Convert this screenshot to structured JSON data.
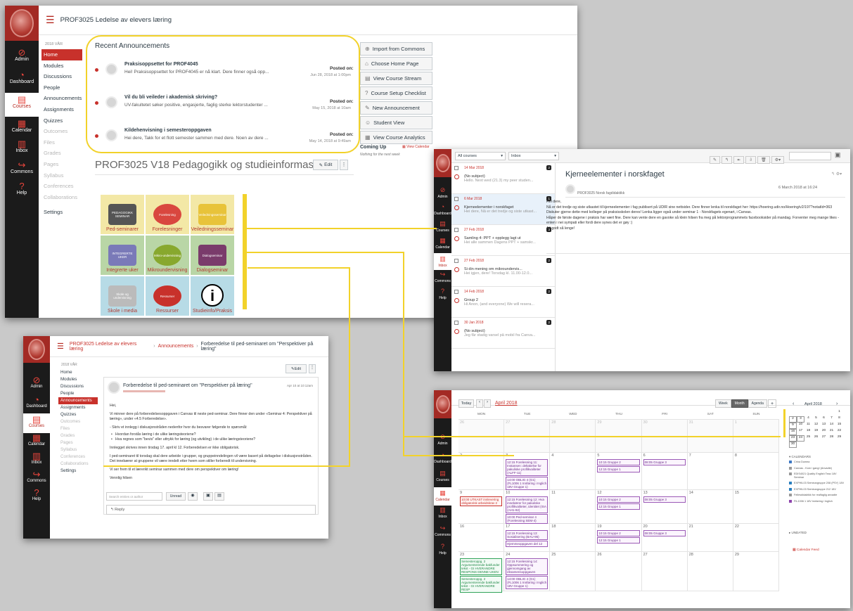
{
  "win1": {
    "course_title": "PROF3025 Ledelse av elevers læring",
    "term": "2018 VÅR",
    "global_nav": [
      "Admin",
      "Dashboard",
      "Courses",
      "Calendar",
      "Inbox",
      "Commons",
      "Help"
    ],
    "course_nav": [
      {
        "label": "Home",
        "state": "active"
      },
      {
        "label": "Modules",
        "state": "normal"
      },
      {
        "label": "Discussions",
        "state": "normal"
      },
      {
        "label": "People",
        "state": "normal"
      },
      {
        "label": "Announcements",
        "state": "normal"
      },
      {
        "label": "Assignments",
        "state": "normal"
      },
      {
        "label": "Quizzes",
        "state": "normal"
      },
      {
        "label": "Outcomes",
        "state": "dim"
      },
      {
        "label": "Files",
        "state": "dim"
      },
      {
        "label": "Grades",
        "state": "dim"
      },
      {
        "label": "Pages",
        "state": "dim"
      },
      {
        "label": "Syllabus",
        "state": "dim"
      },
      {
        "label": "Conferences",
        "state": "dim"
      },
      {
        "label": "Collaborations",
        "state": "dim"
      },
      {
        "label": "Settings",
        "state": "normal"
      }
    ],
    "recent_heading": "Recent Announcements",
    "posted_on": "Posted on:",
    "announcements": [
      {
        "title": "Praksisoppsettet for PROF4045",
        "body": "Hei! Praksisoppsettet for PROF4045 er nå klart. Dere finner også opp...",
        "date": "Jun 28, 2018 at 1:00pm"
      },
      {
        "title": "Vil du bli veileder i akademisk skriving?",
        "body": "UV-fakultetet søker positive, engasjerte, faglig sterke lektorstudenter ...",
        "date": "May 15, 2018 at 10am"
      },
      {
        "title": "Kildehenvisning i semesteroppgaven",
        "body": "Hei dere, Takk for et flott semester sammen med dere. Noen av dere ...",
        "date": "May 14, 2018 at 9:49am"
      }
    ],
    "page_title": "PROF3025 V18 Pedagogikk og studieinformasjon",
    "edit_label": "Edit",
    "side_buttons": [
      {
        "icon": "import-icon",
        "glyph": "⊕",
        "label": "Import from Commons"
      },
      {
        "icon": "home-icon",
        "glyph": "⌂",
        "label": "Choose Home Page"
      },
      {
        "icon": "stream-icon",
        "glyph": "▤",
        "label": "View Course Stream"
      },
      {
        "icon": "checklist-icon",
        "glyph": "?",
        "label": "Course Setup Checklist"
      },
      {
        "icon": "announcement-icon",
        "glyph": "✎",
        "label": "New Announcement"
      },
      {
        "icon": "student-icon",
        "glyph": "☺",
        "label": "Student View"
      },
      {
        "icon": "analytics-icon",
        "glyph": "▦",
        "label": "View Course Analytics"
      }
    ],
    "coming_up": "Coming Up",
    "view_calendar": "View Calendar",
    "nothing": "Nothing for the next week",
    "tiles": [
      {
        "label": "Ped-seminarer",
        "art": "PEDAGOGIKK SEMINAR",
        "bg": "#f3e8a6"
      },
      {
        "label": "Forelesninger",
        "art": "Forelesning",
        "bg": "#f3e8a6"
      },
      {
        "label": "Veiledningsseminar",
        "art": "Veiledningsseminar",
        "bg": "#f3e8a6"
      },
      {
        "label": "Integrerte uker",
        "art": "INTEGRERTE UKER",
        "bg": "#b9d6a6"
      },
      {
        "label": "Mikroundervisning",
        "art": "Mikro-undervisning",
        "bg": "#b9d6a6"
      },
      {
        "label": "Dialogseminar",
        "art": "Dialogseminar",
        "bg": "#b9d6a6"
      },
      {
        "label": "Skole i media",
        "art": "Skole og undervisning",
        "bg": "#b7dbe6"
      },
      {
        "label": "Ressurser",
        "art": "Ressurser",
        "bg": "#b7dbe6"
      },
      {
        "label": "Studieinfo/Praksis",
        "art": "i",
        "bg": "#b7dbe6"
      }
    ]
  },
  "win2": {
    "filter_courses": "All courses",
    "filter_box": "Inbox",
    "messages": [
      {
        "date": "14 Mar 2018",
        "count": "2",
        "subject": "(No subject)",
        "preview": "Hello. Next wed (21.3) my peer studen..."
      },
      {
        "date": "6 Mar 2018",
        "count": "1",
        "subject": "Kjerneelementer i norskfaget",
        "preview": "Hei dere, Nå er det tredje og siste utkast..."
      },
      {
        "date": "27 Feb 2018",
        "count": "3",
        "subject": "Samling 4: PPT + opplegg lagt ut",
        "preview": "Hei alle sammen Dagens PPT + samskr..."
      },
      {
        "date": "27 Feb 2018",
        "count": "2",
        "subject": "Si din mening om mikroundervis...",
        "preview": "Hei igjen, dere! Torsdag kl. 11.00-12.0..."
      },
      {
        "date": "14 Feb 2018",
        "count": "2",
        "subject": "Group 2",
        "preview": "Hi Anon, (and everyone) We will resera..."
      },
      {
        "date": "30 Jan 2018",
        "count": "2",
        "subject": "(No subject)",
        "preview": "Jeg får stadig varsel på mobil fra Canva..."
      }
    ],
    "msg_title": "Kjerneelementer i norskfaget",
    "msg_from": "PROF3025 Norsk fagdidaktikk",
    "msg_date": "6 March 2018 at 16:24",
    "msg_body": [
      "Hei dere,",
      "Nå er det tredje og siste utkastet til kjerneelementer i fag publisert på UDIR sine nettsider. Dere finner lenka til norskfaget her: https://hoering.udir.no/Hoering/v2/197?notatId=363",
      "Diskuter gjerne dette med kolleger på praksisskolen deres! Lenka ligger også under seminar 1 - Norskfagets egenart, i Canvas.",
      "Håper de første dagene i praksis har vært fine. Dere kan vente dere en gavoke så klein hilsen fra meg på lektorprogrammets facebooksider på mandag. Forventer meg mange likes - enten i nei sympati eller fordi dere synes det er gøy :)",
      "Alt godt så lenge!"
    ]
  },
  "win3": {
    "breadcrumb": [
      "PROF3025 Ledelse av elevers læring",
      "Announcements",
      "Forberedelse til ped-seminaret om \"Perspektiver på læring\""
    ],
    "course_nav": [
      {
        "label": "Home",
        "state": "normal"
      },
      {
        "label": "Modules",
        "state": "normal"
      },
      {
        "label": "Discussions",
        "state": "normal"
      },
      {
        "label": "People",
        "state": "normal"
      },
      {
        "label": "Announcements",
        "state": "active"
      },
      {
        "label": "Assignments",
        "state": "normal"
      },
      {
        "label": "Quizzes",
        "state": "normal"
      },
      {
        "label": "Outcomes",
        "state": "dim"
      },
      {
        "label": "Files",
        "state": "dim"
      },
      {
        "label": "Grades",
        "state": "dim"
      },
      {
        "label": "Pages",
        "state": "dim"
      },
      {
        "label": "Syllabus",
        "state": "dim"
      },
      {
        "label": "Conferences",
        "state": "dim"
      },
      {
        "label": "Collaborations",
        "state": "dim"
      },
      {
        "label": "Settings",
        "state": "normal"
      }
    ],
    "title": "Forberedelse til ped-seminaret om \"Perspektiver på læring\"",
    "date": "Apr 10 at 10:12am",
    "greeting": "Hei,",
    "paragraphs": [
      "Vi minner dere på forberedelsesoppgaven i Canvas til neste ped-seminar. Dere finner den under «Seminar 4: Perspektiver på læring», under «4.5 Forberedelse».",
      "- Skriv et innlegg i diskusjonstråden nedenfor hvor du besvarer følgende to spørsmål:",
      "Hvordan forstås læring i de ulike læringsteoriene?",
      "Hva regnes som \"bevis\" eller uttrykk for læring (og utvikling) i de ulike læringsteoriene?",
      "Innlegget skrives innen tirsdag 17. april kl 12. Forberedelsen er ikke obligatorisk.",
      "I ped-seminaret til torsdag skal dere arbeide i grupper, og gruppeinndelingen vil være basert på deltagelse i diskusjonstråden. Det innebærer at gruppene vil være inndelt etter hvem som stiller forberedt til undervisning.",
      "Vi ser frem til et lærerikt seminar sammen med dere om perspektiver om læring!",
      "Vennlig hilsen"
    ],
    "search_placeholder": "Search entries or author",
    "unread": "Unread",
    "reply": "Reply"
  },
  "win4": {
    "today": "Today",
    "month_title": "April 2018",
    "views": [
      "Week",
      "Month",
      "Agenda"
    ],
    "days": [
      "MON",
      "TUE",
      "WED",
      "THU",
      "FRI",
      "SAT",
      "SUN"
    ],
    "weeks": [
      [
        "26",
        "27",
        "28",
        "29",
        "30",
        "31",
        "1"
      ],
      [
        "2",
        "3",
        "4",
        "5",
        "6",
        "7",
        "8"
      ],
      [
        "9",
        "10",
        "11",
        "12",
        "13",
        "14",
        "15"
      ],
      [
        "16",
        "17",
        "18",
        "19",
        "20",
        "21",
        "22"
      ],
      [
        "23",
        "24",
        "25",
        "26",
        "27",
        "28",
        "29"
      ]
    ],
    "events": {
      "1-1": [
        "12:15 Forelesning 11: Instansen: deltakelse for pakuliske profilkvaliteter (ALFF-11)",
        "14:00 OBLIG 4 (G1) (FL1006 1 Innføring i Inglich 18V Gruppe 1)"
      ],
      "1-3": [
        "10:15 Gruppe 2"
      ],
      "1-4": [
        "08:05 Gruppe 3"
      ],
      "1-3b": [
        "12:15 Gruppe 1"
      ],
      "2-0": [
        "10:00 UTKAST innlevering obligatorisk arbeidskrav 2"
      ],
      "2-1": [
        "12:15 Forelesning 12: Hva innebærer for pakuliske profilkvaliteter, identitet (ISA (AH1-92)",
        "10:00 Ped-seminar 4 (Forelesning SEM-4)"
      ],
      "2-3": [
        "10:15 Gruppe 2",
        "12:15 Gruppe 1"
      ],
      "2-4": [
        "08:05 Gruppe 3"
      ],
      "3-1": [
        "12:15 Forelesning 13: Sosialisering (BAU-95)",
        "Hjemmeoppgaven del 12"
      ],
      "3-3": [
        "10:15 Gruppe 2",
        "12:15 Gruppe 1"
      ],
      "3-4": [
        "08:05 Gruppe 3"
      ],
      "4-0": [
        "Semesteroppg. 2 Argumenterende bakfunder tekst - GI HVERANDRE RESPONS DENNE UKEN",
        "Semesteroppg. 2 Argumenterende bakfunder tekst - GI HVERANDRE RESP"
      ],
      "4-1": [
        "12:15 Forelesning 14: Oppsummering og gjennomgang av eksamensoppgaven",
        "14:00 OBLIG 4 (G1) (FL1006 1 Innføring i Inglich 18V Gruppe 1)"
      ]
    },
    "mini_title": "April 2018",
    "mini_rows": [
      [
        "",
        "",
        "",
        "",
        "",
        "",
        "1"
      ],
      [
        "2",
        "3",
        "4",
        "5",
        "6",
        "7",
        "8"
      ],
      [
        "9",
        "10",
        "11",
        "12",
        "13",
        "14",
        "15"
      ],
      [
        "16",
        "17",
        "18",
        "19",
        "20",
        "21",
        "22"
      ],
      [
        "23",
        "24",
        "25",
        "26",
        "27",
        "28",
        "29"
      ],
      [
        "30",
        "",
        "",
        "",
        "",
        "",
        ""
      ]
    ],
    "calendars_heading": "CALENDARS",
    "calendars": [
      {
        "name": "Crina Dumea",
        "color": "#3d78c4"
      },
      {
        "name": "Canvas - Kom i gang! (Anvadte)",
        "color": "#999999"
      },
      {
        "name": "EDIS4021 Quality English Teac 18V Seminar",
        "color": "#999999"
      },
      {
        "name": "EXPHIL03 Seminargruppe 208 (PSY) 18V",
        "color": "#2a7fbf"
      },
      {
        "name": "EXPHIL03 Seminargruppe 212 18V",
        "color": "#2a7fbf"
      },
      {
        "name": "Fellesdidaktikk for realfaglig anvadte",
        "color": "#999999"
      },
      {
        "name": "FIL1006 1 18V Innføring i Inglich",
        "color": "#8e44ad"
      }
    ],
    "undated": "UNDATED",
    "calendar_feed": "Calendar Feed"
  }
}
